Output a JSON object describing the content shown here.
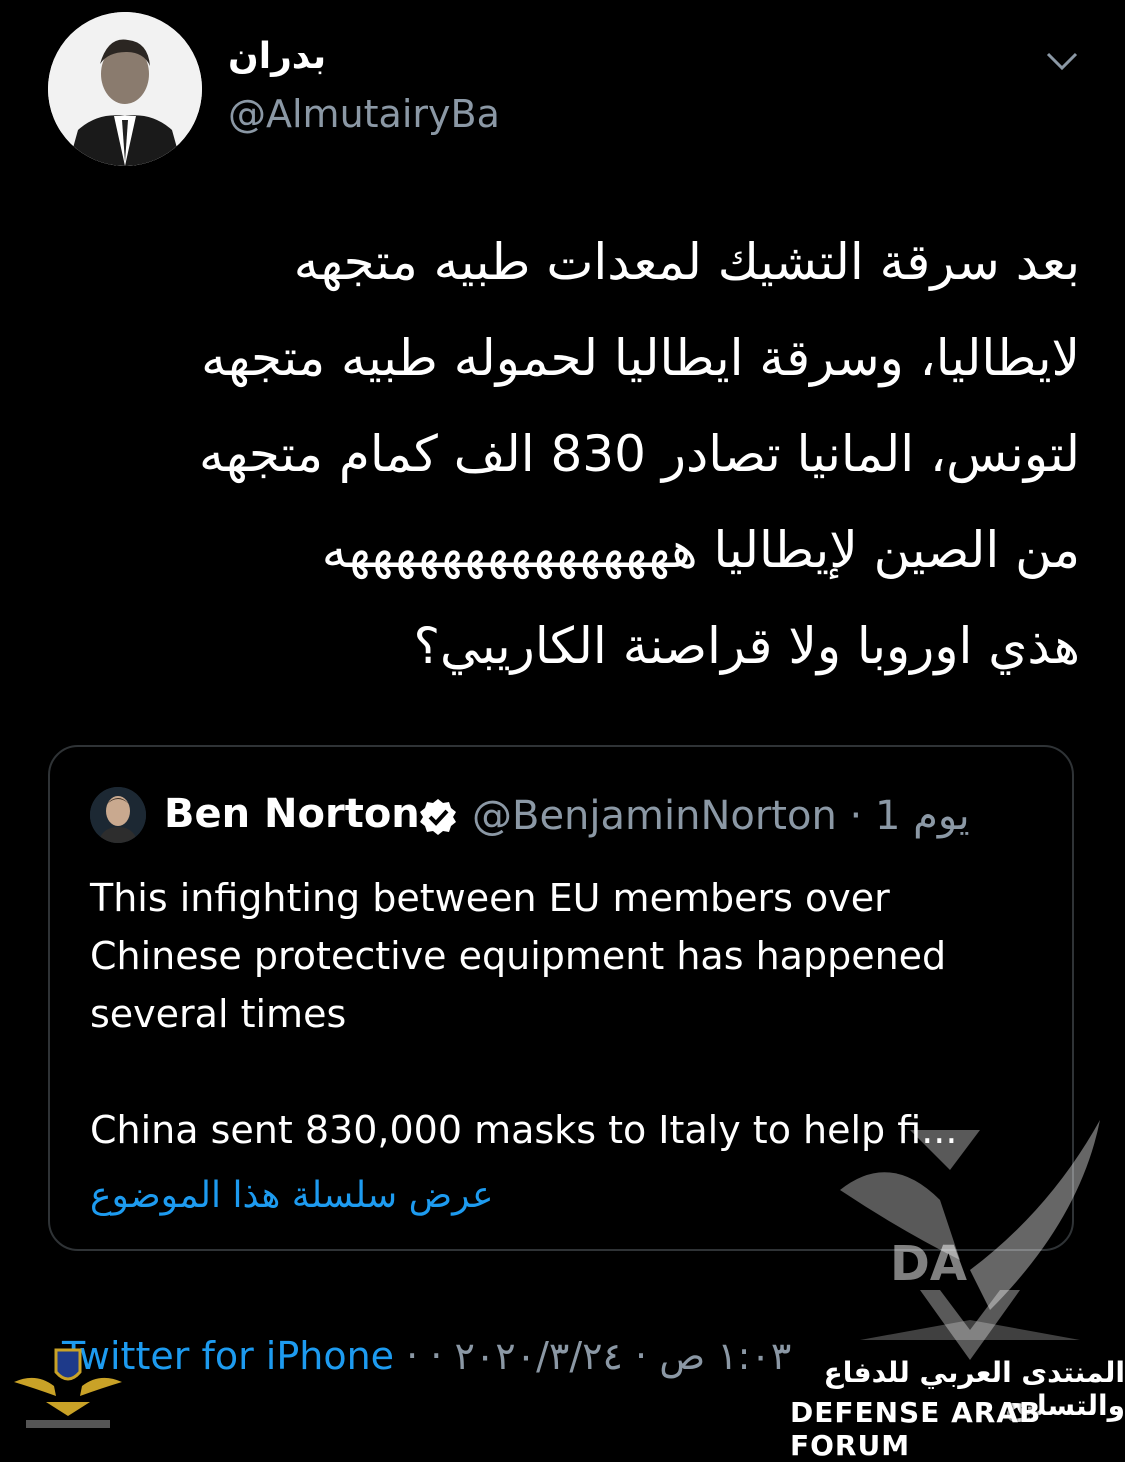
{
  "author": {
    "display_name": "بدران",
    "handle": "@AlmutairyBa"
  },
  "tweet": {
    "lines": [
      "بعد سرقة التشيك لمعدات طبيه متجهه",
      "لايطاليا، وسرقة ايطاليا لحموله طبيه متجهه",
      "لتونس، المانيا تصادر 830 الف كمام متجهه",
      "من الصين لإيطاليا هههههههههههههههه",
      "هذي اوروبا ولا قراصنة الكاريبي؟"
    ]
  },
  "quoted": {
    "name": "Ben Norton",
    "handle_time": "@BenjaminNorton · 1 يوم",
    "text": [
      "This infighting between EU members over Chinese protective equipment has happened several times",
      "China sent 830,000 masks to Italy to help fi..."
    ],
    "thread_link": "عرض سلسلة هذا الموضوع"
  },
  "footer": {
    "timestamp": "١:٠٣ ص · ٢٠٢٠/٣/٢٤ · ",
    "source": "Twitter for iPhone"
  },
  "watermark": {
    "arabic": "المنتدى العربي للدفاع والتسليح",
    "english": "DEFENSE ARAB FORUM",
    "logo_letters": "DA"
  },
  "icons": [
    "chevron-down-icon",
    "verified-badge-icon"
  ],
  "colors": {
    "background": "#000000",
    "secondary_text": "#8b98a5",
    "link": "#1d9bf0",
    "border": "#2f3336"
  }
}
